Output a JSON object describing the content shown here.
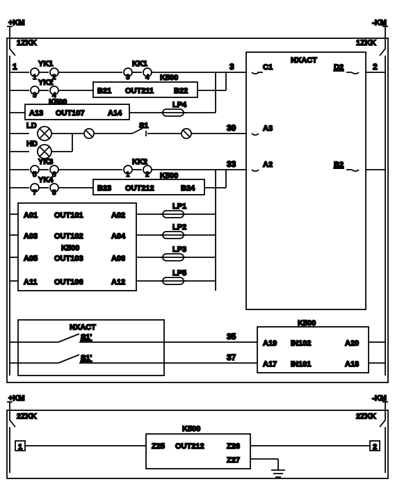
{
  "rails": {
    "plus_km_top": "+KM",
    "minus_km_top": "-KM",
    "plus_km_bot": "+KM",
    "minus_km_bot": "-KM"
  },
  "breakers": {
    "tl": "1ZKK",
    "tr": "1ZKK",
    "bl": "2ZKK",
    "br": "2ZKK"
  },
  "nodes": {
    "n1": "1",
    "n2": "2",
    "n3": "3",
    "n39": "39",
    "n33": "33",
    "n35": "35",
    "n37": "37",
    "nb1": "1",
    "nb2": "2"
  },
  "contacts": {
    "yk1": {
      "label": "YK1",
      "a": "1",
      "b": "2"
    },
    "yk2": {
      "label": "YK2",
      "a": "3",
      "b": "4"
    },
    "yk3": {
      "label": "YK3",
      "a": "5",
      "b": "6"
    },
    "yk4": {
      "label": "YK4",
      "a": "7",
      "b": "8"
    },
    "kk1": {
      "label": "KK1",
      "a": "3",
      "b": "4"
    },
    "kk2": {
      "label": "KK2",
      "a": "1",
      "b": "2"
    },
    "s1": "S1"
  },
  "lamps": {
    "ld": "LD",
    "hd": "HD",
    "lp1": "LP1",
    "lp2": "LP2",
    "lp3": "LP3",
    "lp4": "LP4",
    "lp5": "LP5"
  },
  "modules": {
    "k500_out211": {
      "l": "B21",
      "m": "OUT211",
      "r": "B22",
      "k": "K500"
    },
    "k500_out107": {
      "l": "A13",
      "m": "OUT107",
      "r": "A14",
      "k": "K500"
    },
    "k500_out212": {
      "l": "B23",
      "m": "OUT212",
      "r": "B24",
      "k": "K500"
    },
    "k500_big": {
      "k": "K500",
      "rows": [
        {
          "l": "A01",
          "m": "OUT101",
          "r": "A02"
        },
        {
          "l": "A03",
          "m": "OUT102",
          "r": "A04"
        },
        {
          "l": "A05",
          "m": "OUT103",
          "r": "A06"
        },
        {
          "l": "A11",
          "m": "OUT106",
          "r": "A12"
        }
      ]
    },
    "k500_in": {
      "k": "K500",
      "rows": [
        {
          "l": "A19",
          "m": "IN102",
          "r": "A20"
        },
        {
          "l": "A17",
          "m": "IN101",
          "r": "A18"
        }
      ]
    },
    "k500_bottom": {
      "k": "K500",
      "l": "Z25",
      "m": "OUT212",
      "r1": "Z26",
      "r2": "Z27"
    }
  },
  "nxact": {
    "label": "NXACT",
    "c1": "C1",
    "d2": "D2",
    "a3": "A3",
    "a2": "A2",
    "b2": "B2",
    "s1": "S1'",
    "s1b": "S1'"
  }
}
